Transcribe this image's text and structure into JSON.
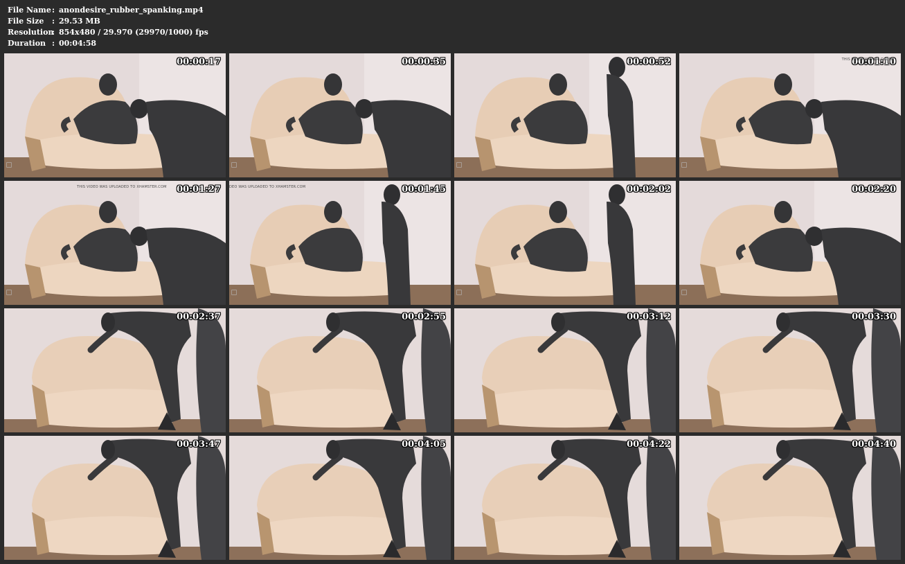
{
  "info": {
    "rows": [
      {
        "label": "File Name",
        "sep": ":",
        "value": "anondesire_rubber_spanking.mp4"
      },
      {
        "label": "File Size",
        "sep": ":",
        "value": "29.53 MB"
      },
      {
        "label": "Resolution",
        "sep": ":",
        "value": "854x480 / 29.970 (29970/1000) fps"
      },
      {
        "label": "Duration",
        "sep": ":",
        "value": "00:04:58"
      }
    ]
  },
  "thumbs": [
    {
      "time": "00:00:17",
      "scene": "sofa",
      "watermark": ""
    },
    {
      "time": "00:00:35",
      "scene": "sofa",
      "watermark": ""
    },
    {
      "time": "00:00:52",
      "scene": "sofa-standing",
      "watermark": ""
    },
    {
      "time": "00:01:10",
      "scene": "sofa",
      "watermark": "THIS VIDEO WAS UPLOADED"
    },
    {
      "time": "00:01:27",
      "scene": "sofa",
      "watermark": "THIS VIDEO WAS UPLOADED TO XHAMSTER.COM"
    },
    {
      "time": "00:01:45",
      "scene": "sofa-standing",
      "watermark": "DEO WAS UPLOADED TO XHAMSTER.COM"
    },
    {
      "time": "00:02:02",
      "scene": "sofa-standing",
      "watermark": ""
    },
    {
      "time": "00:02:20",
      "scene": "sofa",
      "watermark": ""
    },
    {
      "time": "00:02:37",
      "scene": "bent",
      "watermark": ""
    },
    {
      "time": "00:02:55",
      "scene": "bent",
      "watermark": ""
    },
    {
      "time": "00:03:12",
      "scene": "bent",
      "watermark": ""
    },
    {
      "time": "00:03:30",
      "scene": "bent",
      "watermark": ""
    },
    {
      "time": "00:03:47",
      "scene": "bent",
      "watermark": ""
    },
    {
      "time": "00:04:05",
      "scene": "bent",
      "watermark": ""
    },
    {
      "time": "00:04:22",
      "scene": "bent",
      "watermark": ""
    },
    {
      "time": "00:04:40",
      "scene": "bent",
      "watermark": ""
    }
  ],
  "colors": {
    "background": "#2b2b2b",
    "text": "#ffffff",
    "wall": "#e6dcdc",
    "sofa": "#e9cfb6",
    "latex": "#3a3a3c"
  }
}
